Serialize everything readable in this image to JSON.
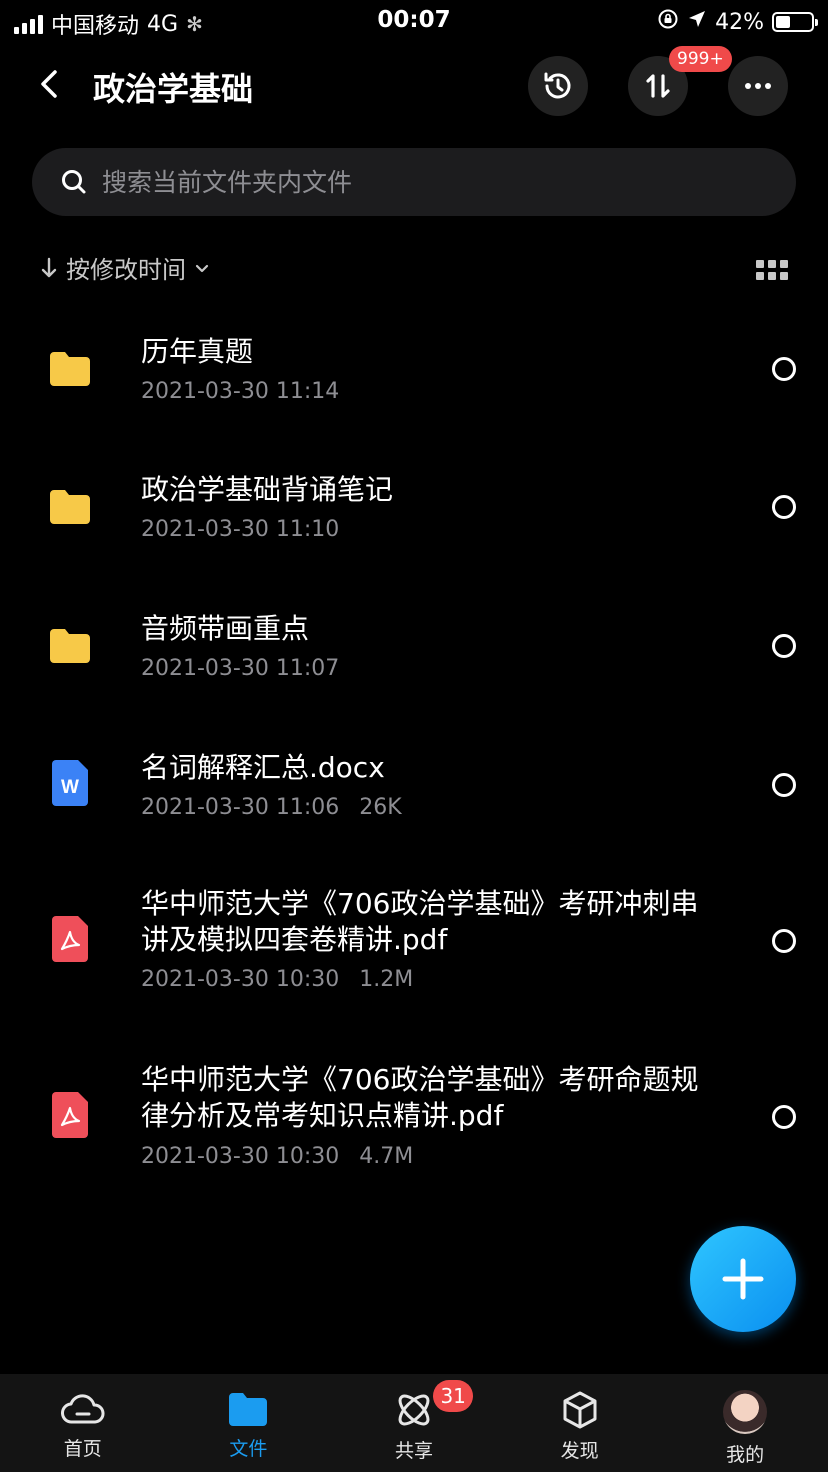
{
  "status_bar": {
    "carrier": "中国移动",
    "network": "4G",
    "time": "00:07",
    "battery": "42%",
    "battery_level": 0.42
  },
  "header": {
    "title": "政治学基础",
    "badge": "999+"
  },
  "search": {
    "placeholder": "搜索当前文件夹内文件"
  },
  "sort": {
    "label": "按修改时间"
  },
  "files": [
    {
      "type": "folder",
      "name": "历年真题",
      "date": "2021-03-30 11:14",
      "size": ""
    },
    {
      "type": "folder",
      "name": "政治学基础背诵笔记",
      "date": "2021-03-30 11:10",
      "size": ""
    },
    {
      "type": "folder",
      "name": "音频带画重点",
      "date": "2021-03-30 11:07",
      "size": ""
    },
    {
      "type": "word",
      "name": "名词解释汇总.docx",
      "date": "2021-03-30 11:06",
      "size": "26K"
    },
    {
      "type": "pdf",
      "name": "华中师范大学《706政治学基础》考研冲刺串讲及模拟四套卷精讲.pdf",
      "date": "2021-03-30 10:30",
      "size": "1.2M"
    },
    {
      "type": "pdf",
      "name": "华中师范大学《706政治学基础》考研命题规律分析及常考知识点精讲.pdf",
      "date": "2021-03-30 10:30",
      "size": "4.7M"
    }
  ],
  "tabbar": {
    "items": [
      {
        "label": "首页",
        "icon": "cloud-icon"
      },
      {
        "label": "文件",
        "icon": "folder-icon"
      },
      {
        "label": "共享",
        "icon": "share-icon",
        "badge": "31"
      },
      {
        "label": "发现",
        "icon": "cube-icon"
      },
      {
        "label": "我的",
        "icon": "avatar"
      }
    ],
    "active": "文件"
  },
  "colors": {
    "accent": "#1b9cf0",
    "folder": "#f7c948",
    "pdf": "#ef4f5a",
    "word": "#3b82f6",
    "badge": "#f04a4a"
  }
}
